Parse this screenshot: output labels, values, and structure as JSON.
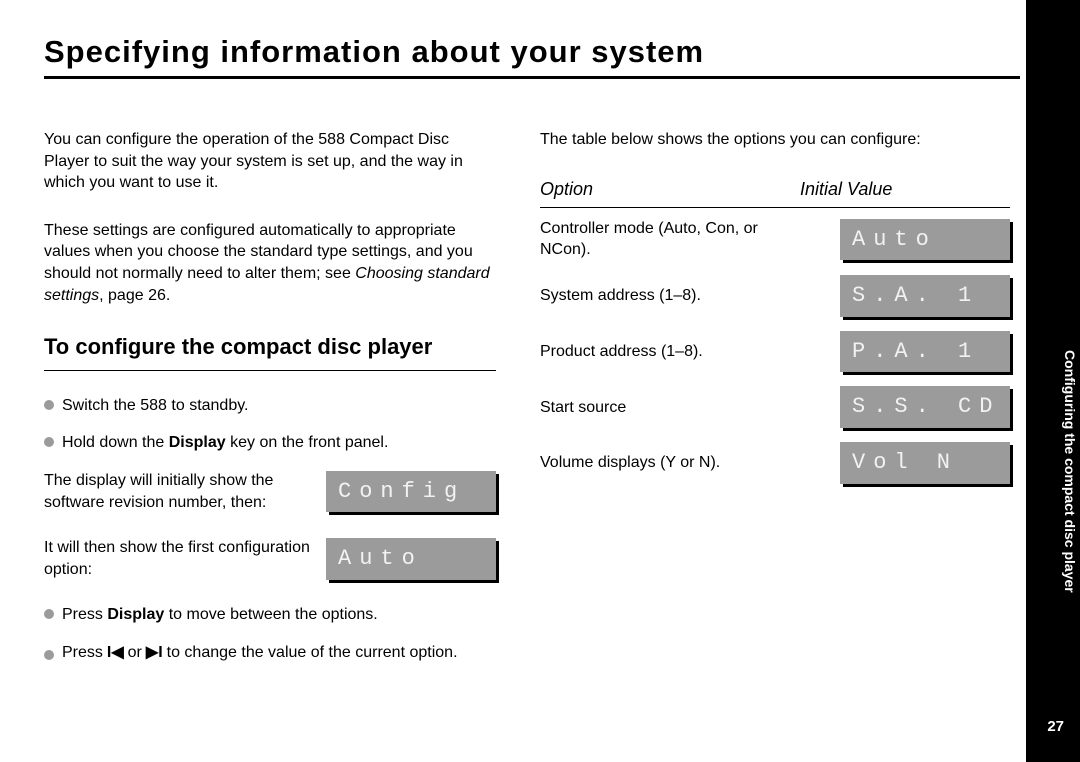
{
  "title": "Specifying information about your system",
  "intro1": "You can configure the operation of the 588 Compact Disc Player to suit the way your system is set up, and the way in which you want to use it.",
  "intro2a": "These settings are configured automatically to appropriate values when you choose the standard type settings, and you should not normally need to alter them; see ",
  "intro2_ital": "Choosing standard settings",
  "intro2b": ", page 26.",
  "subheading": "To configure the compact disc player",
  "step1": "Switch the 588 to standby.",
  "step2a": "Hold down the ",
  "step2_bold": "Display",
  "step2b": " key on the front panel.",
  "disp_note1": "The display will initially show the software revision number, then:",
  "lcd_config": "Config",
  "disp_note2": "It will then show the first configuration option:",
  "lcd_auto": "Auto",
  "step3a": "Press ",
  "step3_bold": "Display",
  "step3b": " to move between the options.",
  "step4a": "Press ",
  "step4b": " or ",
  "step4c": " to change the value of the current option.",
  "right_intro": "The table below shows the options you can configure:",
  "th_option": "Option",
  "th_initial": "Initial Value",
  "opts": [
    {
      "label": "Controller mode (Auto, Con, or NCon).",
      "lcd": "Auto"
    },
    {
      "label": "System address (1–8).",
      "lcd": "S.A. 1"
    },
    {
      "label": "Product address (1–8).",
      "lcd": "P.A. 1"
    },
    {
      "label": "Start source",
      "lcd": "S.S. CD"
    },
    {
      "label": "Volume displays (Y or N).",
      "lcd": "Vol N"
    }
  ],
  "side_bold": "Configuring the compact disc player",
  "side_plain": "",
  "page_num": "27"
}
